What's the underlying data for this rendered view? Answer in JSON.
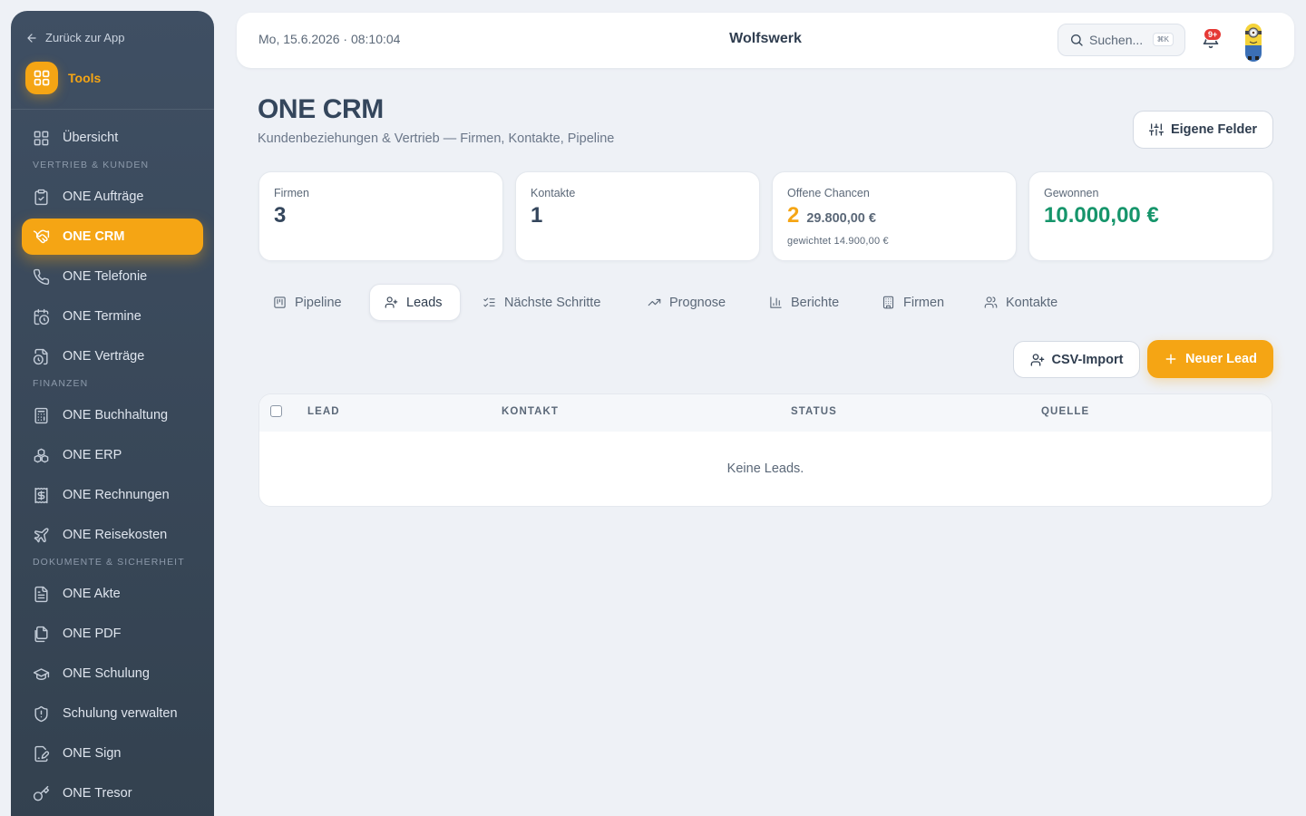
{
  "sidebar": {
    "back_label": "Zurück zur App",
    "tools_label": "Tools",
    "items": [
      {
        "label": "Übersicht",
        "icon": "grid-icon"
      },
      {
        "section": "VERTRIEB & KUNDEN"
      },
      {
        "label": "ONE Aufträge",
        "icon": "clipboard-check-icon"
      },
      {
        "label": "ONE CRM",
        "icon": "handshake-icon",
        "active": true
      },
      {
        "label": "ONE Telefonie",
        "icon": "phone-icon"
      },
      {
        "label": "ONE Termine",
        "icon": "calendar-clock-icon"
      },
      {
        "label": "ONE Verträge",
        "icon": "file-clock-icon"
      },
      {
        "section": "FINANZEN"
      },
      {
        "label": "ONE Buchhaltung",
        "icon": "calculator-icon"
      },
      {
        "label": "ONE ERP",
        "icon": "boxes-icon"
      },
      {
        "label": "ONE Rechnungen",
        "icon": "receipt-dollar-icon"
      },
      {
        "label": "ONE Reisekosten",
        "icon": "plane-icon"
      },
      {
        "section": "DOKUMENTE & SICHERHEIT"
      },
      {
        "label": "ONE Akte",
        "icon": "file-text-icon"
      },
      {
        "label": "ONE PDF",
        "icon": "files-icon"
      },
      {
        "label": "ONE Schulung",
        "icon": "graduation-cap-icon"
      },
      {
        "label": "Schulung verwalten",
        "icon": "shield-alert-icon"
      },
      {
        "label": "ONE Sign",
        "icon": "file-signature-icon"
      },
      {
        "label": "ONE Tresor",
        "icon": "key-icon"
      }
    ]
  },
  "topbar": {
    "datetime": "Mo, 15.6.2026 · 08:10:04",
    "brand": "Wolfswerk",
    "search_placeholder": "Suchen...",
    "search_shortcut": "⌘K",
    "notification_badge": "9+"
  },
  "page": {
    "title": "ONE CRM",
    "subtitle": "Kundenbeziehungen & Vertrieb — Firmen, Kontakte, Pipeline",
    "custom_fields_button": "Eigene Felder"
  },
  "stats": {
    "firmen": {
      "label": "Firmen",
      "value": "3"
    },
    "kontakte": {
      "label": "Kontakte",
      "value": "1"
    },
    "chancen": {
      "label": "Offene Chancen",
      "count": "2",
      "amount": "29.800,00 €",
      "weighted": "gewichtet 14.900,00 €"
    },
    "gewonnen": {
      "label": "Gewonnen",
      "value": "10.000,00 €"
    }
  },
  "tabs": [
    {
      "label": "Pipeline",
      "icon": "kanban-icon"
    },
    {
      "label": "Leads",
      "icon": "user-plus-icon",
      "active": true
    },
    {
      "label": "Nächste Schritte",
      "icon": "list-checks-icon"
    },
    {
      "label": "Prognose",
      "icon": "trending-up-icon"
    },
    {
      "label": "Berichte",
      "icon": "bar-chart-icon"
    },
    {
      "label": "Firmen",
      "icon": "building-icon"
    },
    {
      "label": "Kontakte",
      "icon": "users-icon"
    }
  ],
  "actions": {
    "csv_import": "CSV-Import",
    "new_lead": "Neuer Lead"
  },
  "table": {
    "columns": [
      "LEAD",
      "KONTAKT",
      "STATUS",
      "QUELLE"
    ],
    "empty_text": "Keine Leads."
  },
  "colors": {
    "accent": "#f5a514",
    "sidebar_bg": "#3a4a5c",
    "success": "#16956b",
    "badge": "#e53935"
  }
}
